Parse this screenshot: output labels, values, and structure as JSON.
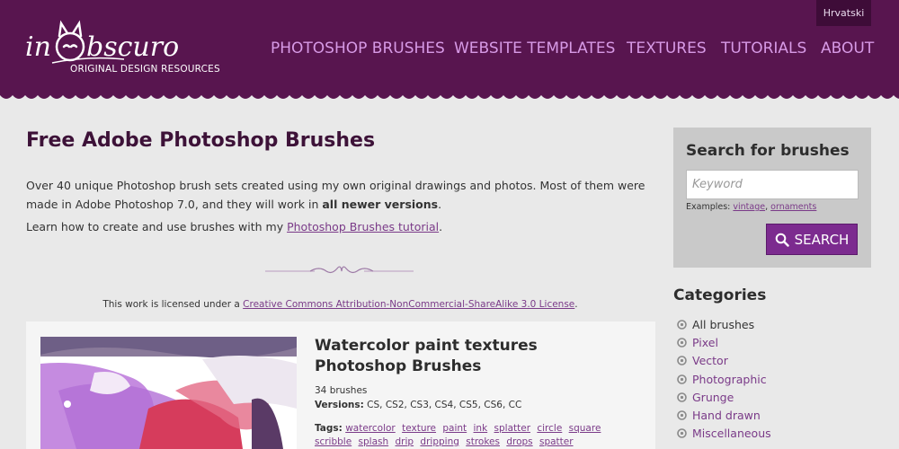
{
  "header": {
    "logo_sub": "ORIGINAL DESIGN RESOURCES",
    "language": "Hrvatski",
    "nav": [
      "PHOTOSHOP BRUSHES",
      "WEBSITE TEMPLATES",
      "TEXTURES",
      "TUTORIALS",
      "ABOUT"
    ]
  },
  "main": {
    "title": "Free Adobe Photoshop Brushes",
    "intro_text": "Over 40 unique Photoshop brush sets created using my own original drawings and photos. Most of them were made in Adobe Photoshop 7.0, and they will work in ",
    "intro_bold": "all newer versions",
    "intro_end": ".",
    "learn_prefix": "Learn how to create and use brushes with my ",
    "learn_link": "Photoshop Brushes tutorial",
    "learn_suffix": ".",
    "license_prefix": "This work is licensed under a ",
    "license_link": "Creative Commons Attribution-NonCommercial-ShareAlike 3.0 License",
    "license_suffix": "."
  },
  "card": {
    "title": "Watercolor paint textures Photoshop Brushes",
    "count": "34 brushes",
    "versions_label": "Versions:",
    "versions_value": " CS, CS2, CS3, CS4, CS5, CS6, CC",
    "tags_label": "Tags:",
    "tags": [
      "watercolor",
      "texture",
      "paint",
      "ink",
      "splatter",
      "circle",
      "square",
      "scribble",
      "splash",
      "drip",
      "dripping",
      "strokes",
      "drops",
      "spatter"
    ]
  },
  "sidebar": {
    "search_title": "Search for brushes",
    "search_placeholder": "Keyword",
    "examples_label": "Examples: ",
    "example_1": "vintage",
    "example_sep": ", ",
    "example_2": "ornaments",
    "search_button": "SEARCH",
    "categories_title": "Categories",
    "categories": [
      "All brushes",
      "Pixel",
      "Vector",
      "Photographic",
      "Grunge",
      "Hand drawn",
      "Miscellaneous"
    ]
  },
  "colors": {
    "header_bg": "#58154f",
    "nav_link": "#d79ae6",
    "accent": "#7c2b8f",
    "page_bg": "#e9e9e9"
  }
}
